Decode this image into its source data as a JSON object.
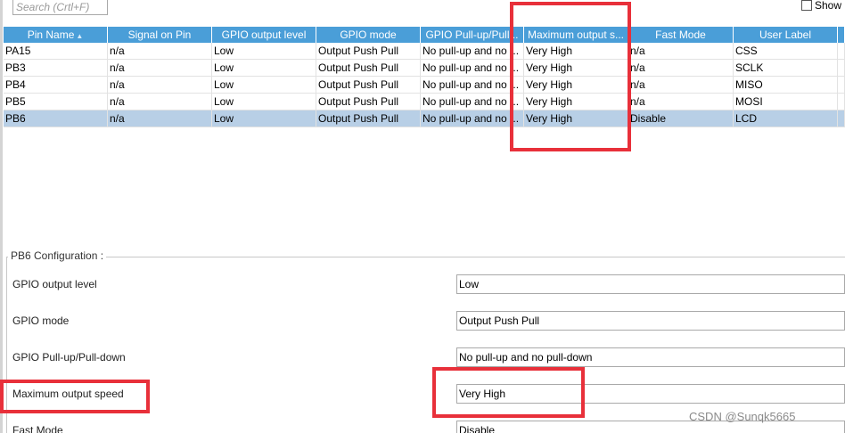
{
  "search": {
    "placeholder": "Search (Crtl+F)"
  },
  "show_checkbox": {
    "label": "Show"
  },
  "table": {
    "columns": [
      "Pin Name",
      "Signal on Pin",
      "GPIO output level",
      "GPIO mode",
      "GPIO Pull-up/Pull...",
      "Maximum output s...",
      "Fast Mode",
      "User Label",
      ""
    ],
    "sort_indicator": "▲",
    "rows": [
      [
        "PA15",
        "n/a",
        "Low",
        "Output Push Pull",
        "No pull-up and no ...",
        "Very High",
        "n/a",
        "CSS",
        ""
      ],
      [
        "PB3",
        "n/a",
        "Low",
        "Output Push Pull",
        "No pull-up and no ...",
        "Very High",
        "n/a",
        "SCLK",
        ""
      ],
      [
        "PB4",
        "n/a",
        "Low",
        "Output Push Pull",
        "No pull-up and no ...",
        "Very High",
        "n/a",
        "MISO",
        ""
      ],
      [
        "PB5",
        "n/a",
        "Low",
        "Output Push Pull",
        "No pull-up and no ...",
        "Very High",
        "n/a",
        "MOSI",
        ""
      ],
      [
        "PB6",
        "n/a",
        "Low",
        "Output Push Pull",
        "No pull-up and no ...",
        "Very High",
        "Disable",
        "LCD",
        ""
      ]
    ],
    "selected_row": 4
  },
  "config": {
    "title": "PB6 Configuration :",
    "params": [
      {
        "label": "GPIO output level",
        "value": "Low"
      },
      {
        "label": "GPIO mode",
        "value": "Output Push Pull"
      },
      {
        "label": "GPIO Pull-up/Pull-down",
        "value": "No pull-up and no pull-down"
      },
      {
        "label": "Maximum output speed",
        "value": "Very High"
      },
      {
        "label": "Fast Mode",
        "value": "Disable"
      }
    ]
  },
  "watermark": "CSDN @Sunqk5665",
  "colors": {
    "header_bg": "#4a9ed8",
    "selected_row_bg": "#b8cfe6",
    "highlight_box": "#e8303a"
  }
}
